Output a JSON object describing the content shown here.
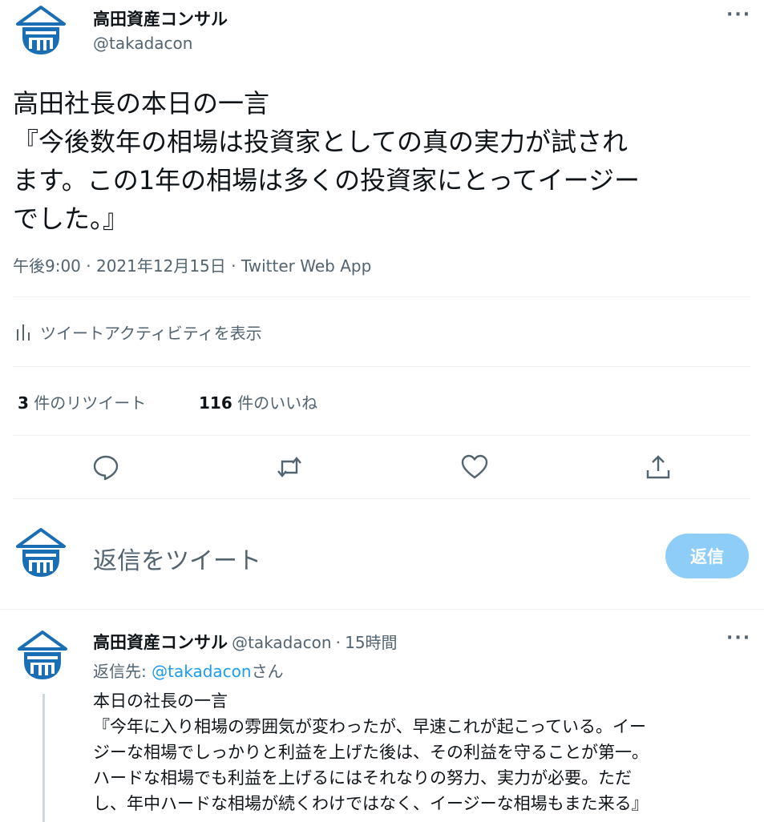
{
  "main_tweet": {
    "author_name": "高田資産コンサル",
    "author_handle": "@takadacon",
    "more_label": "···",
    "text_lines": [
      "高田社長の本日の一言",
      "『今後数年の相場は投資家としての真の実力が試され",
      "ます。この1年の相場は多くの投資家にとってイージー",
      "でした。』"
    ],
    "timestamp": "午後9:00 · 2021年12月15日 · Twitter Web App",
    "activity_label": "ツイートアクティビティを表示",
    "retweet_count": "3",
    "retweet_label": "件のリツイート",
    "like_count": "116",
    "like_label": "件のいいね"
  },
  "compose": {
    "placeholder": "返信をツイート",
    "reply_button": "返信"
  },
  "reply_tweet": {
    "author_name": "高田資産コンサル",
    "author_handle": "@takadacon",
    "separator": "·",
    "time": "15時間",
    "more_label": "···",
    "reply_to_prefix": "返信先: ",
    "reply_to_handle": "@takadacon",
    "reply_to_suffix": "さん",
    "text_lines": [
      "本日の社長の一言",
      "『今年に入り相場の雰囲気が変わったが、早速これが起こっている。イー",
      "ジーな相場でしっかりと利益を上げた後は、その利益を守ることが第一。",
      "ハードな相場でも利益を上げるにはそれなりの努力、実力が必要。ただ",
      "し、年中ハードな相場が続くわけではなく、イージーな相場もまた来る』"
    ]
  },
  "icons": {
    "logo": "takada-logo-icon",
    "activity": "bar-chart-icon",
    "reply": "reply-icon",
    "retweet": "retweet-icon",
    "like": "heart-icon",
    "share": "share-icon"
  },
  "colors": {
    "logo_blue": "#1a6fb4",
    "accent": "#1d9bf0",
    "reply_button_disabled": "#8ecdf8",
    "secondary_text": "#536471"
  }
}
